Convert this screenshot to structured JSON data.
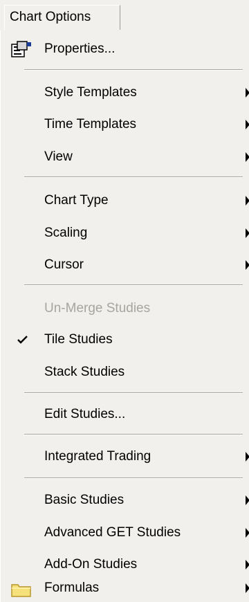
{
  "menubar": {
    "title": "Chart Options"
  },
  "items": {
    "properties": "Properties...",
    "style_templates": "Style Templates",
    "time_templates": "Time Templates",
    "view": "View",
    "chart_type": "Chart Type",
    "scaling": "Scaling",
    "cursor": "Cursor",
    "unmerge_studies": "Un-Merge Studies",
    "tile_studies": "Tile Studies",
    "stack_studies": "Stack Studies",
    "edit_studies": "Edit Studies...",
    "integrated_trading": "Integrated Trading",
    "basic_studies": "Basic Studies",
    "advanced_get_studies": "Advanced GET Studies",
    "addon_studies": "Add-On Studies",
    "formulas": "Formulas"
  },
  "icons": {
    "properties": "properties-icon",
    "tile_check": "checkmark-icon",
    "formulas": "folder-icon",
    "submenu": "submenu-arrow-icon"
  },
  "colors": {
    "menu_bg": "#f1f0ec",
    "disabled_text": "#a6a5a0",
    "folder": "#f6e07a"
  }
}
